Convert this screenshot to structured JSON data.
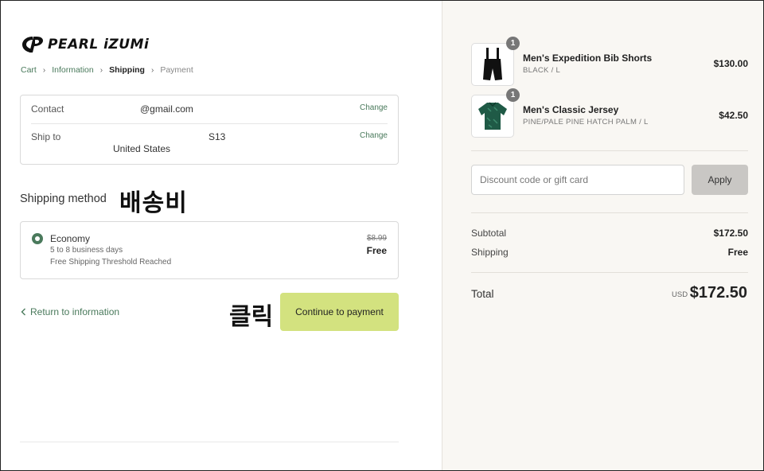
{
  "brand": {
    "logo_text": "PEARL iZUMi",
    "logo_icon": "pearl-izumi-logo-mark"
  },
  "breadcrumbs": [
    {
      "label": "Cart"
    },
    {
      "label": "Information"
    },
    {
      "label": "Shipping"
    },
    {
      "label": "Payment"
    }
  ],
  "info": {
    "contact_label": "Contact",
    "contact_value": "@gmail.com",
    "ship_label": "Ship to",
    "ship_value_line1": "S13",
    "ship_value_line2": "United States",
    "change_label": "Change"
  },
  "shipping": {
    "title": "Shipping method",
    "overlay_text": "배송비",
    "method": {
      "name": "Economy",
      "days": "5 to 8 business days",
      "note": "Free Shipping Threshold Reached",
      "old_price": "$8.99",
      "price": "Free",
      "selected": true
    }
  },
  "actions": {
    "return_label": "Return to information",
    "overlay_click": "클릭",
    "continue_label": "Continue to payment"
  },
  "cart": {
    "items": [
      {
        "name": "Men's Expedition Bib Shorts",
        "variant": "BLACK / L",
        "price": "$130.00",
        "quantity": "1",
        "image_icon": "bib-shorts-image"
      },
      {
        "name": "Men's Classic Jersey",
        "variant": "PINE/PALE PINE HATCH PALM / L",
        "price": "$42.50",
        "quantity": "1",
        "image_icon": "jersey-image"
      }
    ],
    "discount_placeholder": "Discount code or gift card",
    "apply_label": "Apply",
    "subtotal_label": "Subtotal",
    "subtotal_value": "$172.50",
    "shipping_label": "Shipping",
    "shipping_value": "Free",
    "total_label": "Total",
    "total_currency": "USD",
    "total_value": "$172.50"
  },
  "colors": {
    "accent": "#4a7a5c",
    "continue_button": "#d3e27f",
    "sidebar_bg": "#f9f7f3",
    "apply_button": "#c9c7c4"
  }
}
